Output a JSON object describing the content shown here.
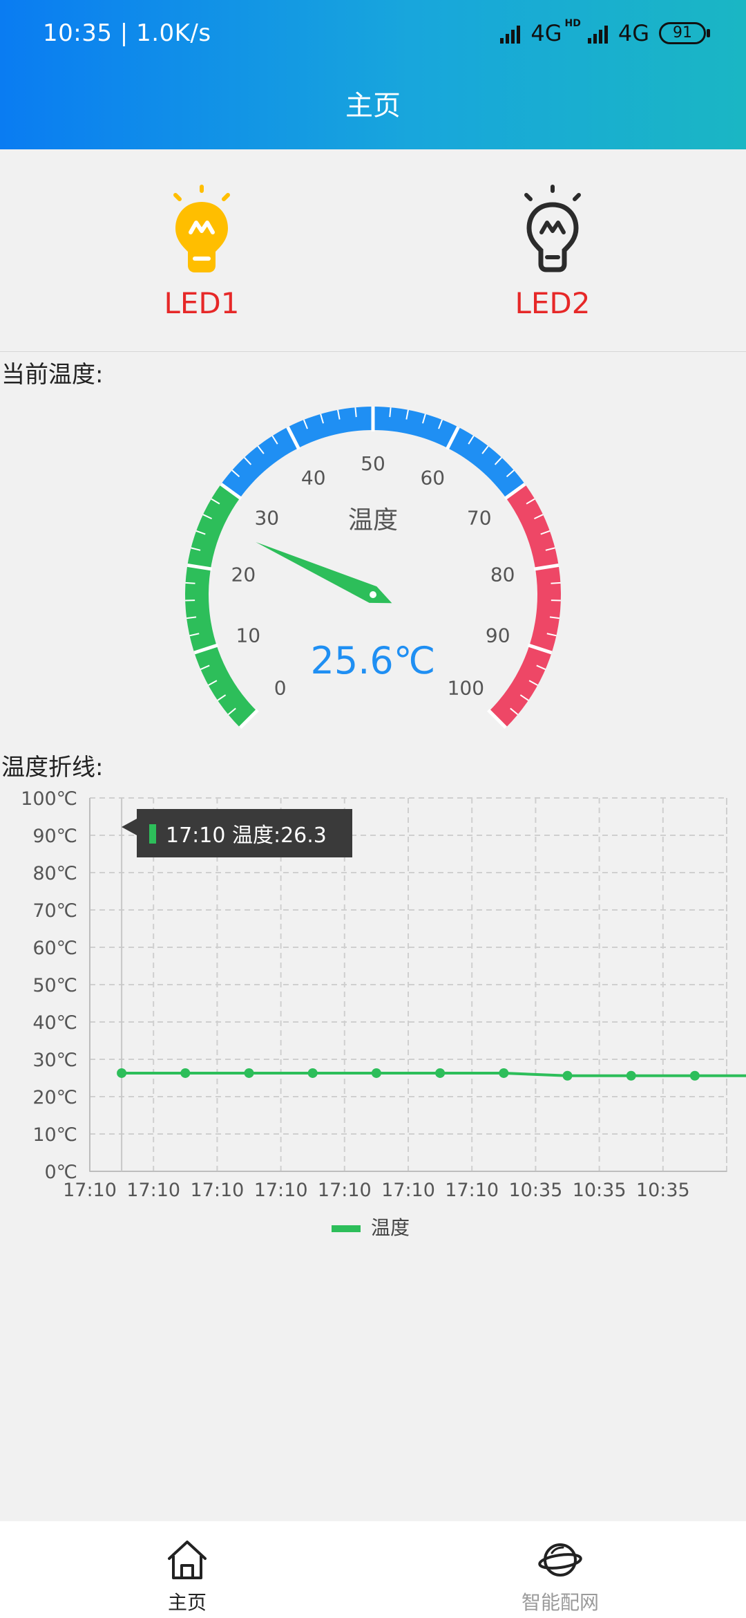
{
  "status_bar": {
    "time": "10:35",
    "speed": "1.0K/s",
    "network1": "4G",
    "hd_label": "HD",
    "network2": "4G",
    "battery": "91"
  },
  "header": {
    "title": "主页"
  },
  "leds": [
    {
      "label": "LED1",
      "state": "on",
      "color": "#ffbe00"
    },
    {
      "label": "LED2",
      "state": "off",
      "color": "#2b2b2b"
    }
  ],
  "current_temp_label": "当前温度:",
  "gauge": {
    "min": 0,
    "max": 100,
    "ticks": [
      "0",
      "10",
      "20",
      "30",
      "40",
      "50",
      "60",
      "70",
      "80",
      "90",
      "100"
    ],
    "title": "温度",
    "value": 25.6,
    "value_text": "25.6℃",
    "colors": {
      "low": "#2dbe5a",
      "mid": "#1f8ff3",
      "high": "#ee4766",
      "needle": "#2dbe5a",
      "value": "#1f8ff3"
    }
  },
  "line_label": "温度折线:",
  "chart_data": {
    "type": "line",
    "x": [
      "17:10",
      "17:10",
      "17:10",
      "17:10",
      "17:10",
      "17:10",
      "17:10",
      "10:35",
      "10:35",
      "10:35"
    ],
    "series": [
      {
        "name": "温度",
        "color": "#2dbe5a",
        "values": [
          26.3,
          26.3,
          26.3,
          26.3,
          26.3,
          26.3,
          26.3,
          25.6,
          25.6,
          25.6
        ]
      }
    ],
    "ylim": [
      0,
      100
    ],
    "yticks": [
      "0℃",
      "10℃",
      "20℃",
      "30℃",
      "40℃",
      "50℃",
      "60℃",
      "70℃",
      "80℃",
      "90℃",
      "100℃"
    ],
    "grid": true,
    "legend": "bottom-center",
    "tooltip": "17:10 温度:26.3"
  },
  "tabbar": {
    "items": [
      {
        "label": "主页",
        "active": true
      },
      {
        "label": "智能配网",
        "active": false
      }
    ]
  }
}
